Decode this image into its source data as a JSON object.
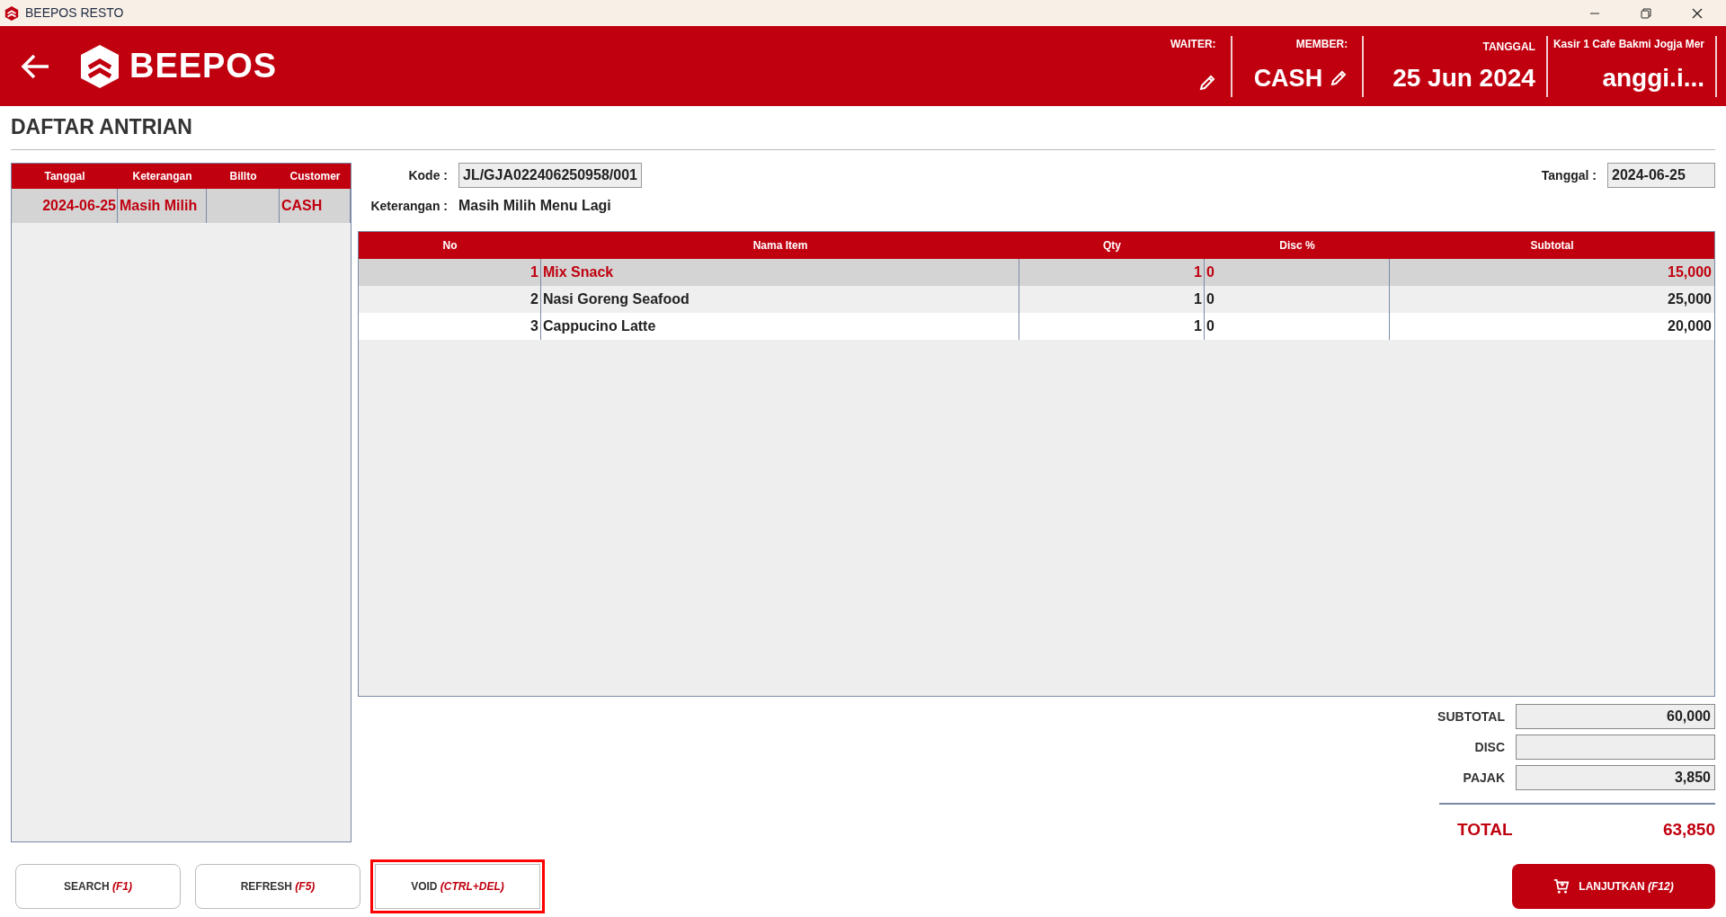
{
  "window": {
    "title": "BEEPOS RESTO"
  },
  "header": {
    "logo": "BEEPOS",
    "waiter_label": "WAITER:",
    "member_label": "MEMBER:",
    "member_value": "CASH",
    "date_label": "TANGGAL",
    "date_value": "25 Jun 2024",
    "cashier_label": "Kasir 1 Cafe Bakmi Jogja Mer",
    "user": "anggi.i..."
  },
  "page_title": "DAFTAR ANTRIAN",
  "queue": {
    "columns": [
      "Tanggal",
      "Keterangan",
      "Billto",
      "Customer"
    ],
    "rows": [
      {
        "cells": [
          "2024-06-25",
          "Masih Milih",
          "",
          "CASH"
        ],
        "selected": true
      }
    ]
  },
  "detail": {
    "kode_label": "Kode :",
    "kode_value": "JL/GJA022406250958/001",
    "tanggal_label": "Tanggal :",
    "tanggal_value": "2024-06-25",
    "keterangan_label": "Keterangan :",
    "keterangan_value": "Masih Milih Menu Lagi"
  },
  "items": {
    "columns": [
      "No",
      "Nama Item",
      "Qty",
      "Disc %",
      "Subtotal"
    ],
    "rows": [
      {
        "cells": [
          "1",
          "Mix Snack",
          "1",
          "0",
          "15,000"
        ],
        "selected": true
      },
      {
        "cells": [
          "2",
          "Nasi Goreng Seafood",
          "1",
          "0",
          "25,000"
        ],
        "selected": false
      },
      {
        "cells": [
          "3",
          "Cappucino Latte",
          "1",
          "0",
          "20,000"
        ],
        "selected": false
      }
    ]
  },
  "totals": [
    {
      "label": "SUBTOTAL",
      "value": "60,000"
    },
    {
      "label": "DISC"
    },
    {
      "label": "PAJAK",
      "value": "3,850"
    }
  ],
  "total": {
    "label": "TOTAL",
    "value": "63,850"
  },
  "buttons": [
    {
      "label": "SEARCH",
      "shortcut": "(F1)",
      "focused": false
    },
    {
      "label": "REFRESH",
      "shortcut": "(F5)",
      "focused": false
    },
    {
      "label": "VOID",
      "shortcut": "(CTRL+DEL)",
      "focused": true
    }
  ],
  "primary_button": {
    "label": "LANJUTKAN",
    "shortcut": "(F12)"
  }
}
